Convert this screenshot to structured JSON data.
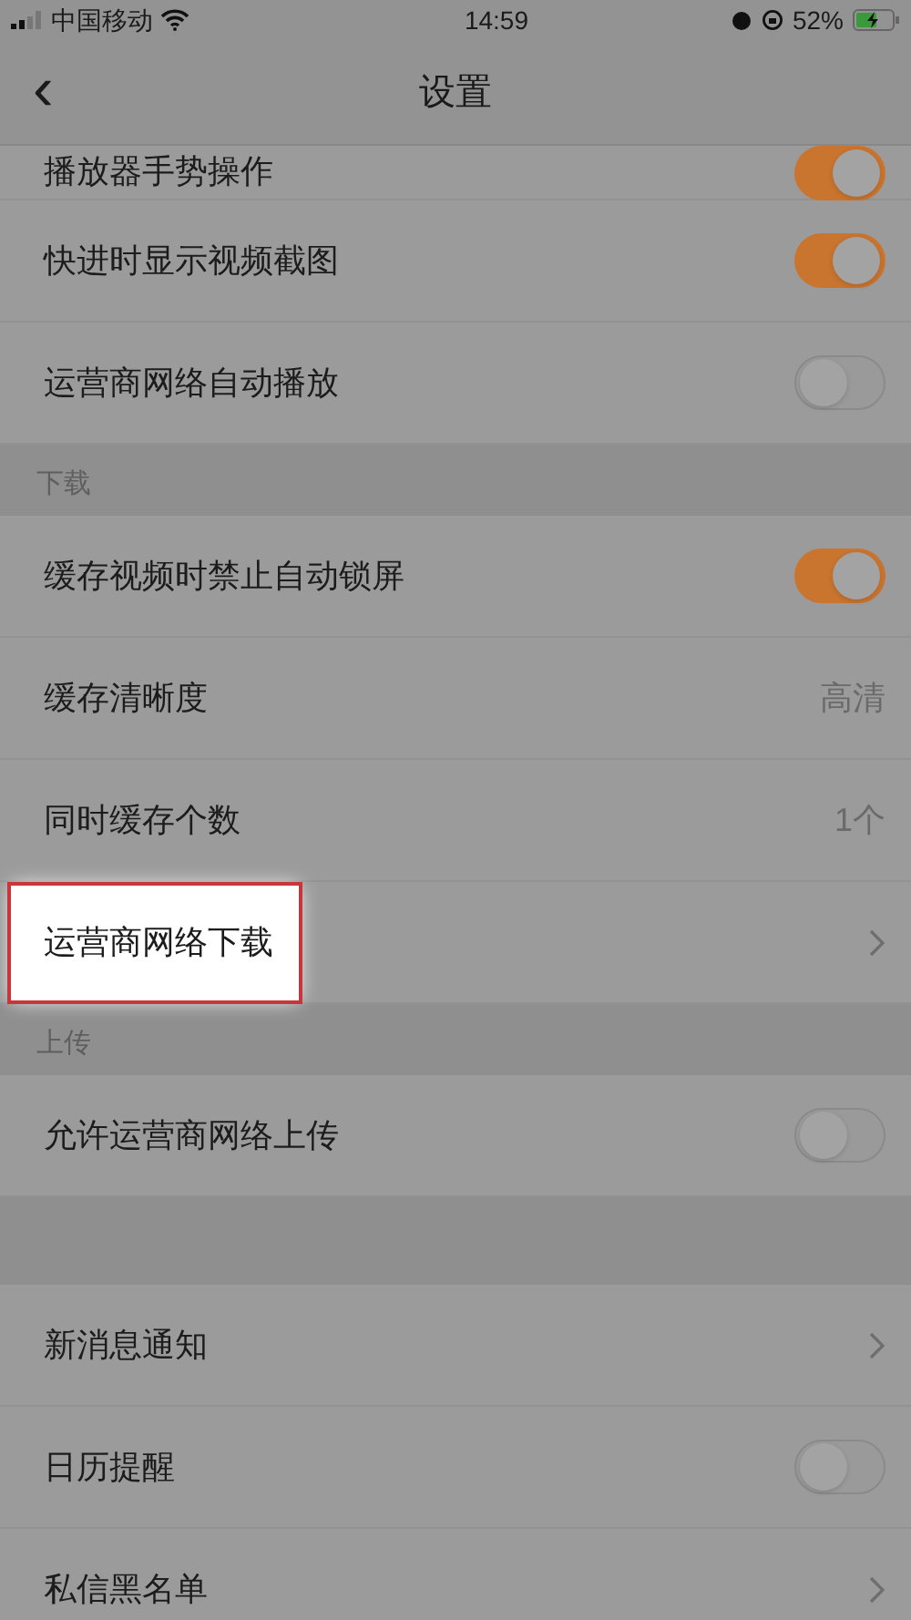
{
  "status_bar": {
    "carrier": "中国移动",
    "time": "14:59",
    "battery": "52%"
  },
  "nav": {
    "back": "‹",
    "title": "设置"
  },
  "sections": [
    {
      "items": [
        {
          "kind": "toggle",
          "label": "播放器手势操作",
          "on": true,
          "partial": true
        },
        {
          "kind": "toggle",
          "label": "快进时显示视频截图",
          "on": true
        },
        {
          "kind": "toggle",
          "label": "运营商网络自动播放",
          "on": false
        }
      ]
    },
    {
      "header": "下载",
      "items": [
        {
          "kind": "toggle",
          "label": "缓存视频时禁止自动锁屏",
          "on": true
        },
        {
          "kind": "value",
          "label": "缓存清晰度",
          "value": "高清"
        },
        {
          "kind": "value",
          "label": "同时缓存个数",
          "value": "1个"
        },
        {
          "kind": "link",
          "label": "运营商网络下载",
          "highlighted": true
        }
      ]
    },
    {
      "header": "上传",
      "items": [
        {
          "kind": "toggle",
          "label": "允许运营商网络上传",
          "on": false
        }
      ]
    },
    {
      "items": [
        {
          "kind": "link",
          "label": "新消息通知"
        },
        {
          "kind": "toggle",
          "label": "日历提醒",
          "on": false
        },
        {
          "kind": "link",
          "label": "私信黑名单"
        }
      ]
    }
  ]
}
